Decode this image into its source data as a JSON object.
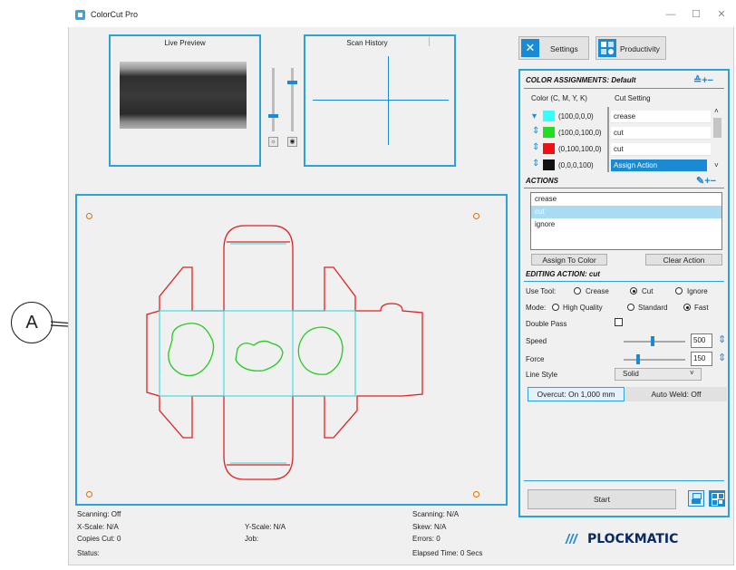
{
  "window": {
    "title": "ColorCut Pro",
    "minimize": "—",
    "maximize": "☐",
    "close": "✕"
  },
  "preview": {
    "live_title": "Live Preview",
    "history_title": "Scan History"
  },
  "toolbar": {
    "settings_label": "Settings",
    "productivity_label": "Productivity"
  },
  "color_assignments": {
    "title": "COLOR ASSIGNMENTS: Default",
    "col_color": "Color (C, M, Y, K)",
    "col_cut": "Cut Setting",
    "rows": [
      {
        "cmyk": "(100,0,0,0)",
        "color": "#33ffff",
        "setting": "crease"
      },
      {
        "cmyk": "(100,0,100,0)",
        "color": "#22dd22",
        "setting": "cut"
      },
      {
        "cmyk": "(0,100,100,0)",
        "color": "#ee1111",
        "setting": "cut"
      },
      {
        "cmyk": "(0,0,0,100)",
        "color": "#111111",
        "setting": "Assign Action"
      }
    ]
  },
  "actions": {
    "title": "ACTIONS",
    "items": [
      "crease",
      "cut",
      "ignore"
    ],
    "selected": "cut",
    "assign_label": "Assign To Color",
    "clear_label": "Clear Action"
  },
  "editing": {
    "title": "EDITING ACTION: cut",
    "use_tool_label": "Use Tool:",
    "tool_options": [
      "Crease",
      "Cut",
      "Ignore"
    ],
    "tool_selected": "Cut",
    "mode_label": "Mode:",
    "mode_options": [
      "High Quality",
      "Standard",
      "Fast"
    ],
    "mode_selected": "Fast",
    "double_pass_label": "Double Pass",
    "speed_label": "Speed",
    "speed_value": "500",
    "force_label": "Force",
    "force_value": "150",
    "line_style_label": "Line Style",
    "line_style_value": "Solid",
    "overcut_label": "Overcut: On 1,000 mm",
    "autoweld_label": "Auto Weld: Off"
  },
  "start_label": "Start",
  "status": {
    "scanning_left": "Scanning:   Off",
    "xscale": "X-Scale: N/A",
    "copies": "Copies Cut:  0",
    "status": "Status:",
    "yscale": "Y-Scale: N/A",
    "job": "Job:",
    "scanning_right": "Scanning:  N/A",
    "skew": "Skew:     N/A",
    "errors": "Errors:  0",
    "elapsed": "Elapsed Time:  0 Secs"
  },
  "brand": "PLOCKMATIC",
  "callout": "A",
  "colors": {
    "accent": "#29a3d8",
    "crease": "#33e6e6",
    "cut_red": "#e02020",
    "cut_green": "#22cc22"
  }
}
